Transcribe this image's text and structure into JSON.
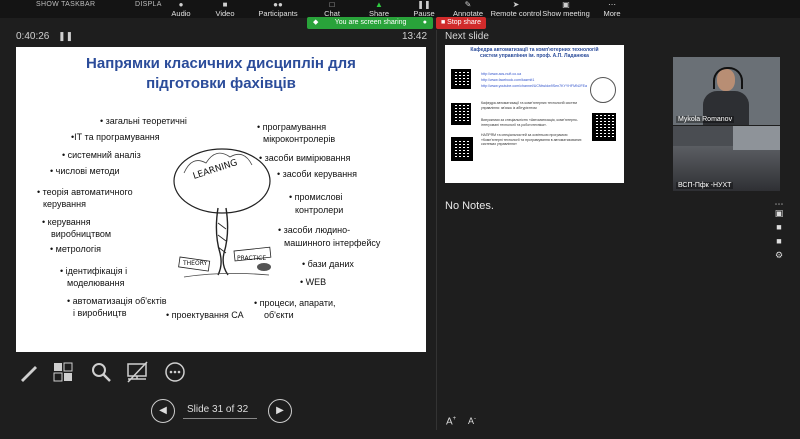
{
  "toolbar": {
    "left_labels": [
      "SHOW TASKBAR",
      "DISPLA"
    ],
    "items": [
      {
        "label": "Audio",
        "icon": "microphone-icon"
      },
      {
        "label": "Video",
        "icon": "camera-icon"
      },
      {
        "label": "Participants",
        "icon": "participants-icon"
      },
      {
        "label": "Chat",
        "icon": "chat-icon"
      },
      {
        "label": "Share",
        "icon": "share-icon"
      },
      {
        "label": "Pause",
        "icon": "pause-icon"
      },
      {
        "label": "Annotate",
        "icon": "annotate-icon"
      },
      {
        "label": "Remote control",
        "icon": "remote-control-icon"
      },
      {
        "label": "Show meeting",
        "icon": "show-meeting-icon"
      },
      {
        "label": "More",
        "icon": "more-icon"
      }
    ],
    "sharing_status": "You are screen sharing",
    "stop_share": "Stop share"
  },
  "presenter": {
    "elapsed": "0:40:26",
    "clock": "13:42",
    "next_slide_label": "Next slide",
    "notes": "No Notes.",
    "slide_counter": "Slide 31 of 32"
  },
  "slide": {
    "title_line1": "Напрямки класичних дисциплін для",
    "title_line2": "підготовки фахівців",
    "items": {
      "general": "загальні теоретичні",
      "it": "ІТ та програмування",
      "system": "системний аналіз",
      "numeric": "числові методи",
      "theory_auto_1": "теорія автоматичного",
      "theory_auto_2": "керування",
      "production_1": "керування",
      "production_2": "виробництвом",
      "metrology": "метрологія",
      "ident_1": "ідентифікація і",
      "ident_2": "моделювання",
      "automation_1": "автоматизація об'єктів",
      "automation_2": "і виробництв",
      "design": "проектування СА",
      "processes_1": "процеси, апарати,",
      "processes_2": "об'єкти",
      "web": "WEB",
      "db": "бази даних",
      "hmi_1": "засоби людино-",
      "hmi_2": "машинного інтерфейсу",
      "plc_1": "промислові",
      "plc_2": "контролери",
      "control_means": "засоби керування",
      "measure": "засоби вимірювання",
      "micro_1": "програмування",
      "micro_2": "мікроконтролерів"
    },
    "tree_words": {
      "learning": "LEARNING",
      "theory": "THEORY",
      "practice": "PRACTICE"
    }
  },
  "next_slide": {
    "title_1": "Кафедра автоматизації та комп'ютерних технологій",
    "title_2": "систем управління ім. проф. А.П. Ладанюка",
    "links": [
      "http://www.acs-nuft.co.ua",
      "http://www.facebook.com/kazmit1",
      "http://www.youtube.com/channel/UCNtwIdw9Sen7KYYHFMNJFEa"
    ],
    "text_1": "Кафедра автоматизації та комп'ютерних технологій систем управління: зв'язок із абітурієнтом",
    "text_2": "Випускники за спеціальністю «Автоматизація, комп'ютерно-інтегровані технології та робототехніка».",
    "text_3": "НАПРЯМ та спеціальностей за освітньою програмою «Комп'ютерні технології та програмування в автоматизованих системах управління»"
  },
  "videos": [
    {
      "name": "Mykola Romanov"
    },
    {
      "name": "ВСП-Пфк -НУХТ"
    }
  ],
  "colors": {
    "accent_green": "#29a33a",
    "stop_red": "#d12b2b",
    "slide_title": "#2b4c9a"
  }
}
